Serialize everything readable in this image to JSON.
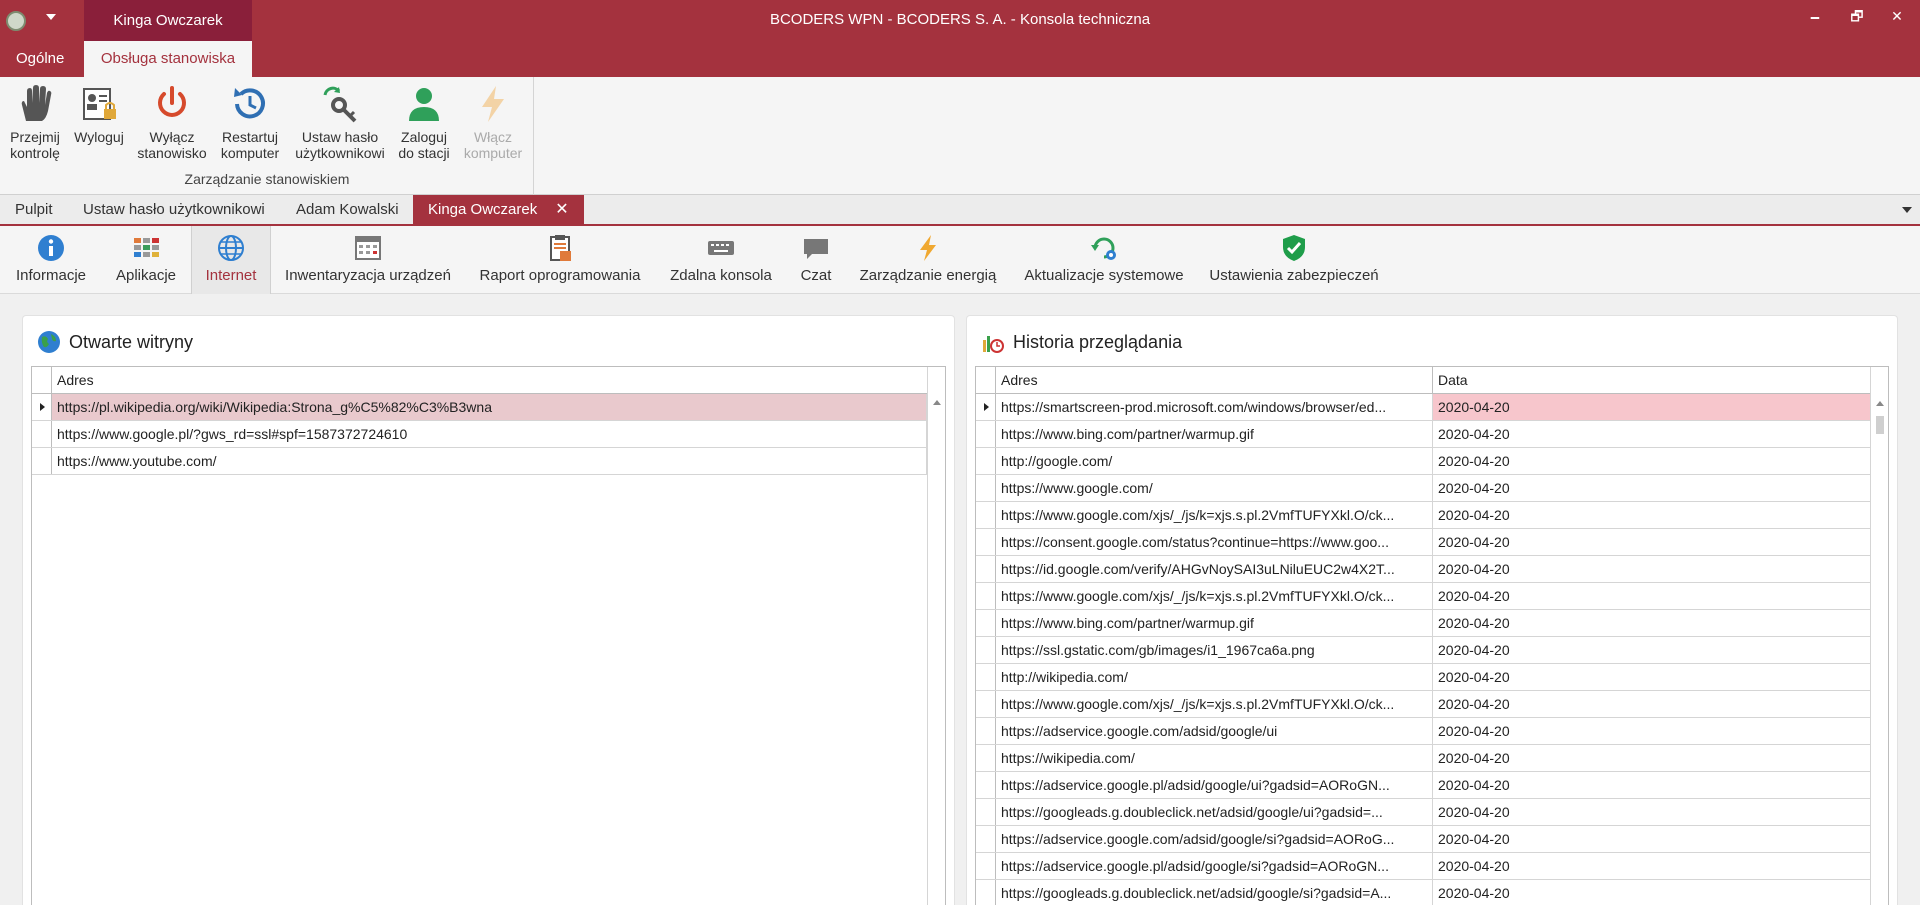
{
  "window": {
    "title": "BCODERS WPN - BCODERS S. A. - Konsola techniczna",
    "context_tab": "Kinga Owczarek",
    "controls": {
      "minimize": "🗕",
      "restore": "🗗",
      "close": "✕"
    }
  },
  "ribbon_tabs": [
    "Ogólne",
    "Obsługa stanowiska"
  ],
  "ribbon": {
    "group_label": "Zarządzanie stanowiskiem",
    "buttons": [
      {
        "line1": "Przejmij",
        "line2": "kontrolę",
        "icon": "hand-icon"
      },
      {
        "line1": "Wyloguj",
        "line2": "",
        "icon": "logout-user-icon"
      },
      {
        "line1": "Wyłącz",
        "line2": "stanowisko",
        "icon": "power-icon"
      },
      {
        "line1": "Restartuj",
        "line2": "komputer",
        "icon": "restart-icon"
      },
      {
        "line1": "Ustaw hasło",
        "line2": "użytkownikowi",
        "icon": "key-icon"
      },
      {
        "line1": "Zaloguj",
        "line2": "do stacji",
        "icon": "login-user-icon"
      },
      {
        "line1": "Włącz",
        "line2": "komputer",
        "icon": "lightning-icon",
        "disabled": true
      }
    ]
  },
  "doc_tabs": [
    "Pulpit",
    "Ustaw hasło użytkownikowi",
    "Adam Kowalski",
    "Kinga Owczarek"
  ],
  "subtoolbar": [
    {
      "label": "Informacje",
      "icon": "info-icon"
    },
    {
      "label": "Aplikacje",
      "icon": "apps-icon"
    },
    {
      "label": "Internet",
      "icon": "globe-icon"
    },
    {
      "label": "Inwentaryzacja urządzeń",
      "icon": "inventory-icon"
    },
    {
      "label": "Raport oprogramowania",
      "icon": "report-icon"
    },
    {
      "label": "Zdalna konsola",
      "icon": "keyboard-icon"
    },
    {
      "label": "Czat",
      "icon": "chat-icon"
    },
    {
      "label": "Zarządzanie energią",
      "icon": "energy-icon"
    },
    {
      "label": "Aktualizacje systemowe",
      "icon": "update-icon"
    },
    {
      "label": "Ustawienia zabezpieczeń",
      "icon": "shield-icon"
    }
  ],
  "open_sites": {
    "title": "Otwarte witryny",
    "column": "Adres",
    "rows": [
      "https://pl.wikipedia.org/wiki/Wikipedia:Strona_g%C5%82%C3%B3wna",
      "https://www.google.pl/?gws_rd=ssl#spf=1587372724610",
      "https://www.youtube.com/"
    ]
  },
  "history": {
    "title": "Historia przeglądania",
    "columns": [
      "Adres",
      "Data"
    ],
    "rows": [
      [
        "https://smartscreen-prod.microsoft.com/windows/browser/ed...",
        "2020-04-20"
      ],
      [
        "https://www.bing.com/partner/warmup.gif",
        "2020-04-20"
      ],
      [
        "http://google.com/",
        "2020-04-20"
      ],
      [
        "https://www.google.com/",
        "2020-04-20"
      ],
      [
        "https://www.google.com/xjs/_/js/k=xjs.s.pl.2VmfTUFYXkl.O/ck...",
        "2020-04-20"
      ],
      [
        "https://consent.google.com/status?continue=https://www.goo...",
        "2020-04-20"
      ],
      [
        "https://id.google.com/verify/AHGvNoySAI3uLNiluEUC2w4X2T...",
        "2020-04-20"
      ],
      [
        "https://www.google.com/xjs/_/js/k=xjs.s.pl.2VmfTUFYXkl.O/ck...",
        "2020-04-20"
      ],
      [
        "https://www.bing.com/partner/warmup.gif",
        "2020-04-20"
      ],
      [
        "https://ssl.gstatic.com/gb/images/i1_1967ca6a.png",
        "2020-04-20"
      ],
      [
        "http://wikipedia.com/",
        "2020-04-20"
      ],
      [
        "https://www.google.com/xjs/_/js/k=xjs.s.pl.2VmfTUFYXkl.O/ck...",
        "2020-04-20"
      ],
      [
        "https://adservice.google.com/adsid/google/ui",
        "2020-04-20"
      ],
      [
        "https://wikipedia.com/",
        "2020-04-20"
      ],
      [
        "https://adservice.google.pl/adsid/google/ui?gadsid=AORoGN...",
        "2020-04-20"
      ],
      [
        "https://googleads.g.doubleclick.net/adsid/google/ui?gadsid=...",
        "2020-04-20"
      ],
      [
        "https://adservice.google.com/adsid/google/si?gadsid=AORoG...",
        "2020-04-20"
      ],
      [
        "https://adservice.google.pl/adsid/google/si?gadsid=AORoGN...",
        "2020-04-20"
      ],
      [
        "https://googleads.g.doubleclick.net/adsid/google/si?gadsid=A...",
        "2020-04-20"
      ]
    ]
  },
  "colors": {
    "accent": "#a4323e",
    "context_tab": "#8a1f3a",
    "selected_row": "#e9c9cd"
  }
}
